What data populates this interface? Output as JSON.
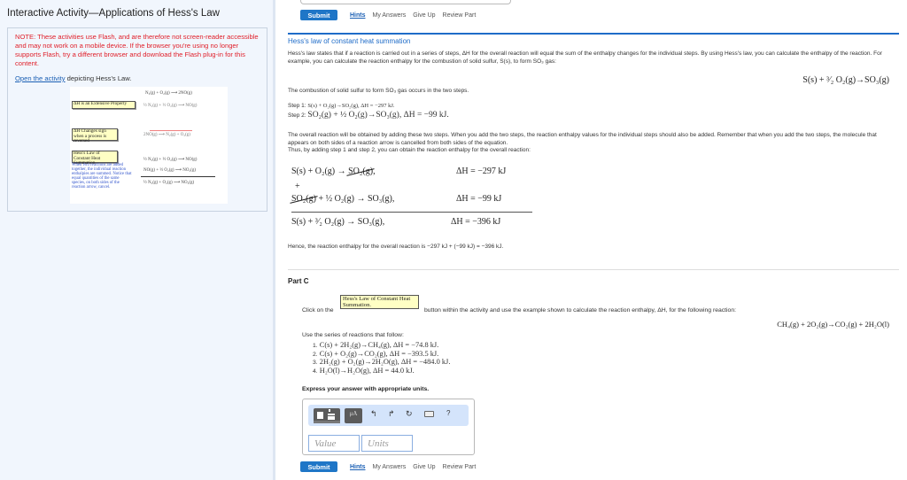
{
  "left": {
    "title": "Interactive Activity—Applications of Hess's Law",
    "note": "NOTE: These activities use Flash, and are therefore not screen-reader accessible and may not work on a mobile device. If the browser you're using no longer supports Flash, try a different browser and download the Flash plug-in for this content.",
    "open_link": "Open the activity",
    "open_rest": " depicting Hess's Law.",
    "activity": {
      "buttons": [
        "ΔH is an Extensive Property",
        "ΔH Changes sign when a process is reversed",
        "Hess's Law of Constant Heat Summation."
      ],
      "blue_text": "When two reactions are added together, the individual reaction enthalpies are summed. Notice that equal quantities of the same species, on both sides of the reaction arrow, cancel.",
      "reactions": [
        "N₂(g) + O₂(g) ⟶ 2NO(g)",
        "½ N₂(g) + ½ O₂(g) ⟶ NO(g)",
        "2NO(g) ⟶ N₂(g) + O₂(g)",
        "½ N₂(g) + ½ O₂(g) ⟶ NO(g)",
        "NO(g) + ½ O₂(g) ⟶ NO₂(g)",
        "½ N₂(g) + O₂(g) ⟶ NO₂(g)"
      ]
    }
  },
  "toolbar_top": {
    "submit": "Submit",
    "hints": "Hints",
    "my_answers": "My Answers",
    "give_up": "Give Up",
    "review_part": "Review Part"
  },
  "section": {
    "title": "Hess's law of constant heat summation",
    "intro": "Hess's law states that if a reaction is carried out in a series of steps, ΔH for the overall reaction will equal the sum of the enthalpy changes for the individual steps. By using Hess's law, you can calculate the enthalpy of the reaction. For example, you can calculate the reaction enthalpy for the combustion of solid sulfur, S(s), to form SO₃ gas:",
    "overall_eq": "S(s) + ³⁄₂ O₂(g)→SO₃(g)",
    "two_steps": "The combustion of solid sulfur to form SO₃ gas occurs in the two steps.",
    "step1_label": "Step 1:",
    "step1": "S(s) + O₂(g)→SO₂(g), ΔH = −297 kJ.",
    "step2_label": "Step 2:",
    "step2": "SO₂(g) + ½ O₂(g)→SO₃(g), ΔH = −99 kJ.",
    "adding_text": "The overall reaction will be obtained by adding these two steps. When you add the two steps, the reaction enthalpy values for the individual steps should also be added. Remember that when you add the two steps, the molecule that appears on both sides of a reaction arrow is cancelled from both sides of the equation.",
    "thus_text": "Thus, by adding step 1 and step 2, you can obtain the reaction enthalpy for the overall reaction:",
    "sum": {
      "row1_lhs": "S(s)  +  O₂(g)  → ",
      "row1_cancel": "SO₂(g)",
      "row1_dh": "ΔH = −297 kJ",
      "plus": "+",
      "row2_cancel": "SO₂(g)",
      "row2_rhs": "  +  ½ O₂(g) → SO₃(g),",
      "row2_dh": "ΔH = −99 kJ",
      "row3": "S(s)  +  ³⁄₂ O₂(g)  → SO₃(g),",
      "row3_dh": "ΔH = −396 kJ"
    },
    "hence": "Hence, the reaction enthalpy for the overall reaction is −297 kJ + (−99 kJ) = −396 kJ."
  },
  "partc": {
    "title": "Part C",
    "click_on": "Click on the",
    "hess_button": "Hess's Law of Constant Heat Summation.",
    "click_rest": "button within the activity and use the example shown to calculate the reaction enthalpy, ΔH, for the following reaction:",
    "target_eq": "CH₄(g) + 2O₂(g)→CO₂(g) + 2H₂O(l)",
    "use_series": "Use the series of reactions that follow:",
    "reactions": [
      {
        "n": "1.",
        "eq": "C(s) + 2H₂(g)→CH₄(g), ΔH = −74.8 kJ."
      },
      {
        "n": "2.",
        "eq": "C(s) + O₂(g)→CO₂(g), ΔH = −393.5 kJ."
      },
      {
        "n": "3.",
        "eq": "2H₂(g) + O₂(g)→2H₂O(g), ΔH = −484.0 kJ."
      },
      {
        "n": "4.",
        "eq": "H₂O(l)→H₂O(g), ΔH = 44.0 kJ."
      }
    ],
    "express": "Express your answer with appropriate units.",
    "answer": {
      "tools": [
        "templates-icon",
        "units-icon",
        "undo-icon",
        "redo-icon",
        "reset-icon",
        "keyboard-icon",
        "help-icon"
      ],
      "units_label": "μA",
      "help_label": "?",
      "value_placeholder": "Value",
      "units_placeholder": "Units"
    },
    "submit": "Submit",
    "hints": "Hints",
    "my_answers": "My Answers",
    "give_up": "Give Up",
    "review_part": "Review Part"
  }
}
